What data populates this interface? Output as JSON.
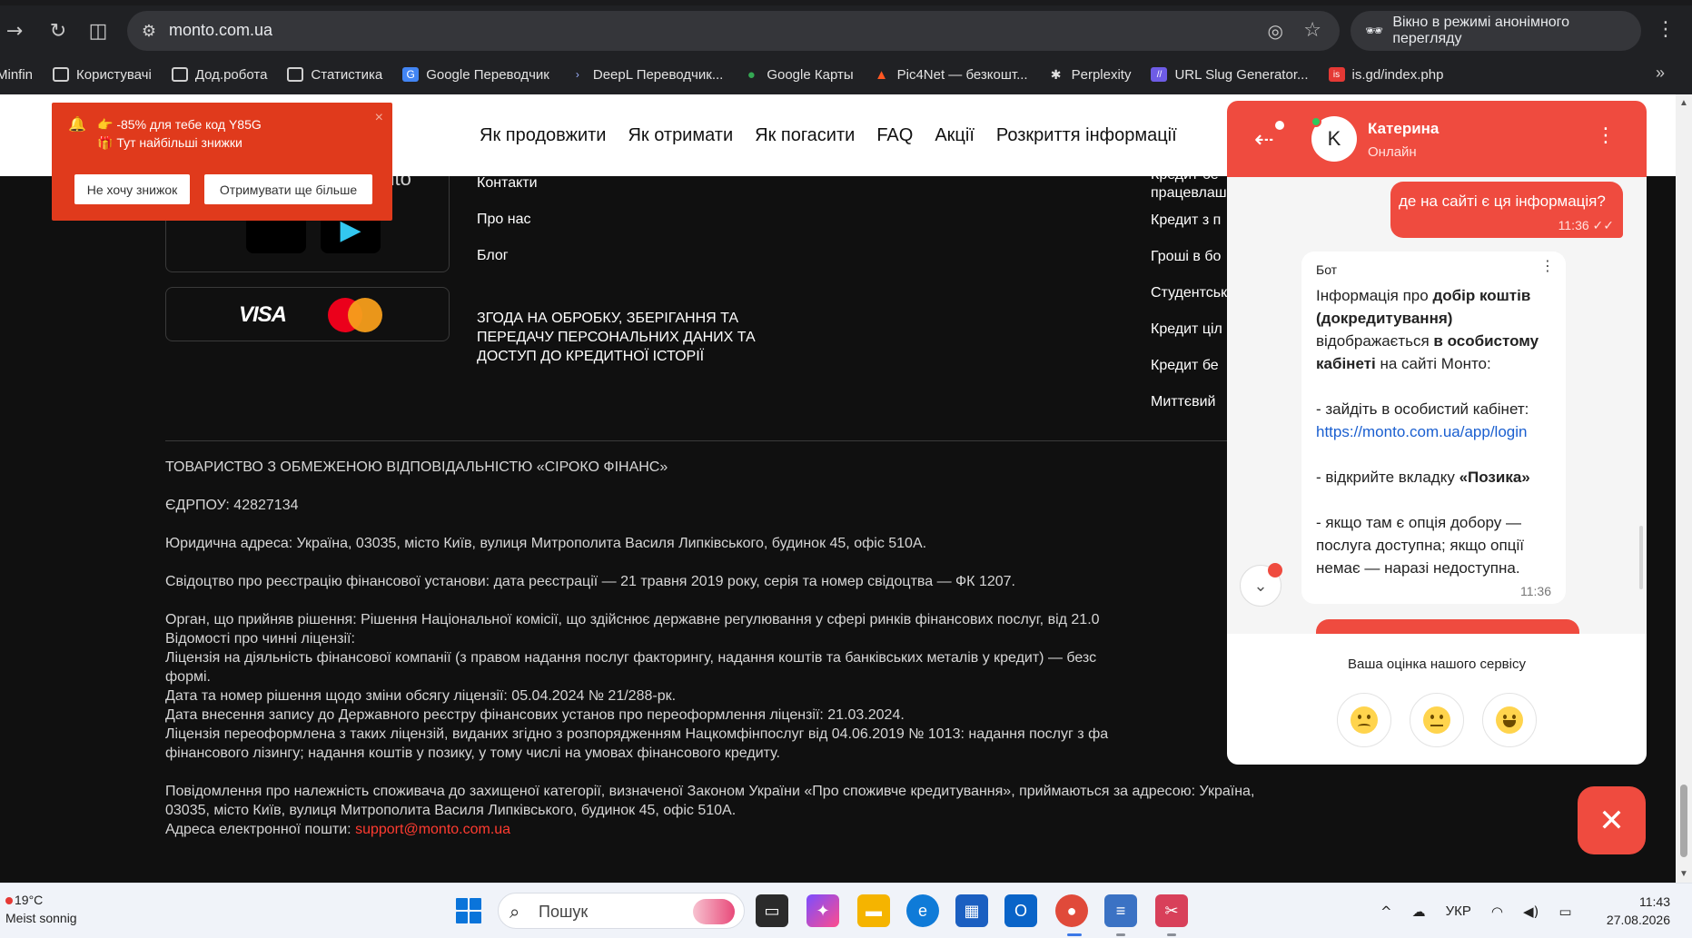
{
  "browser": {
    "url": "monto.com.ua",
    "incognito_label": "Вікно в режимі анонімного перегляду",
    "bookmarks": [
      {
        "label": "Minfin",
        "icon": "none"
      },
      {
        "label": "Користувачі",
        "icon": "folder-icon"
      },
      {
        "label": "Дод.робота",
        "icon": "folder-icon"
      },
      {
        "label": "Статистика",
        "icon": "folder-icon"
      },
      {
        "label": "Google Переводчик",
        "icon": "translate-icon"
      },
      {
        "label": "DeepL Переводчик...",
        "icon": "deepl-icon"
      },
      {
        "label": "Google Карты",
        "icon": "maps-pin-icon"
      },
      {
        "label": "Pic4Net — безкошт...",
        "icon": "pic4net-icon"
      },
      {
        "label": "Perplexity",
        "icon": "perplexity-icon"
      },
      {
        "label": "URL Slug Generator...",
        "icon": "slug-icon"
      },
      {
        "label": "is.gd/index.php",
        "icon": "isgd-icon"
      }
    ]
  },
  "site": {
    "nav": [
      "Як продовжити",
      "Як отримати",
      "Як погасити",
      "FAQ",
      "Акції",
      "Розкриття інформації"
    ],
    "store_logo_text": "onto",
    "footer_links": [
      "Контакти",
      "Про нас",
      "Блог"
    ],
    "consent_link": "ЗГОДА НА ОБРОБКУ, ЗБЕРІГАННЯ ТА ПЕРЕДАЧУ ПЕРСОНАЛЬНИХ ДАНИХ ТА ДОСТУП ДО КРЕДИТНОЇ ІСТОРІЇ",
    "right_links": [
      "Кредит бе",
      "працевлаш",
      "Кредит з п",
      "Гроші в бо",
      "Студентськ",
      "Кредит ціл",
      "Кредит бе",
      "Миттєвий"
    ],
    "payment": {
      "visa": "VISA"
    },
    "legal": {
      "company": "ТОВАРИСТВО З ОБМЕЖЕНОЮ ВІДПОВІДАЛЬНІСТЮ «СІРОКО ФІНАНС»",
      "edrpou": "ЄДРПОУ: 42827134",
      "address": "Юридична адреса: Україна, 03035, місто Київ, вулиця Митрополита Василя Липківського, будинок 45, офіс 510А.",
      "certificate": "Свідоцтво про реєстрацію фінансової установи: дата реєстрації — 21 травня 2019 року, серія та номер свідоцтва — ФК 1207.",
      "organ": "Орган, що прийняв рішення: Рішення Національної комісії, що здійснює державне регулювання у сфері ринків фінансових послуг, від 21.0",
      "licenses_title": "Відомості про чинні ліцензії:",
      "license_line1": "Ліцензія на діяльність фінансової компанії (з правом надання послуг факторингу, надання коштів та банківських металів у кредит) — безс",
      "license_line2": "формі.",
      "decision": "Дата та номер рішення щодо зміни обсягу ліцензії: 05.04.2024 № 21/288-рк.",
      "registry_date": "Дата внесення запису до Державного реєстру фінансових установ про переоформлення ліцензії: 21.03.2024.",
      "reissued_line1": "Ліцензія переоформлена з таких ліцензій, виданих згідно з розпорядженням Нацкомфінпослуг від 04.06.2019 № 1013: надання послуг з фа",
      "reissued_line2": "фінансового лізингу; надання коштів у позику, у тому числі на умовах фінансового кредиту.",
      "notice_line1": "Повідомлення про належність споживача до захищеної категорії, визначеної Законом України «Про споживче кредитування», приймаються за адресою: Україна,",
      "notice_line2": "03035, місто Київ, вулиця Митрополита Василя Липківського, будинок 45, офіс 510А.",
      "email_label": "Адреса електронної пошти: ",
      "email": "support@monto.com.ua"
    }
  },
  "promo": {
    "line1": "-85% для тебе код Y85G",
    "line2": "Тут найбільші знижки",
    "decline": "Не хочу знижок",
    "accept": "Отримувати ще більше",
    "close": "×"
  },
  "chat": {
    "agent_initial": "K",
    "agent_name": "Катерина",
    "agent_status": "Онлайн",
    "user_message": "де на сайті є ця інформація?",
    "user_time": "11:36",
    "bot_label": "Бот",
    "bot_p1_a": "Інформація про ",
    "bot_p1_b": "добір коштів (докредитування)",
    "bot_p1_c": " відображається ",
    "bot_p1_d": "в особистому кабінеті",
    "bot_p1_e": " на сайті Монто:",
    "bot_p2": "- зайдіть в особистий кабінет:",
    "bot_link": "https://monto.com.ua/app/login",
    "bot_p3_a": "- відкрийте вкладку ",
    "bot_p3_b": "«Позика»",
    "bot_p4": "- якщо там є опція добору — послуга доступна; якщо опції немає — наразі недоступна.",
    "bot_time": "11:36",
    "rating_title": "Ваша оцінка нашого сервісу"
  },
  "taskbar": {
    "temperature": "19°C",
    "weather": "Meist sonnig",
    "search_placeholder": "Пошук",
    "lang": "УКР",
    "time": "11:43",
    "date": "27.08.2026"
  },
  "colors": {
    "accent": "#ef4b3f",
    "promo": "#e03a1c",
    "link": "#1a5fd0"
  }
}
